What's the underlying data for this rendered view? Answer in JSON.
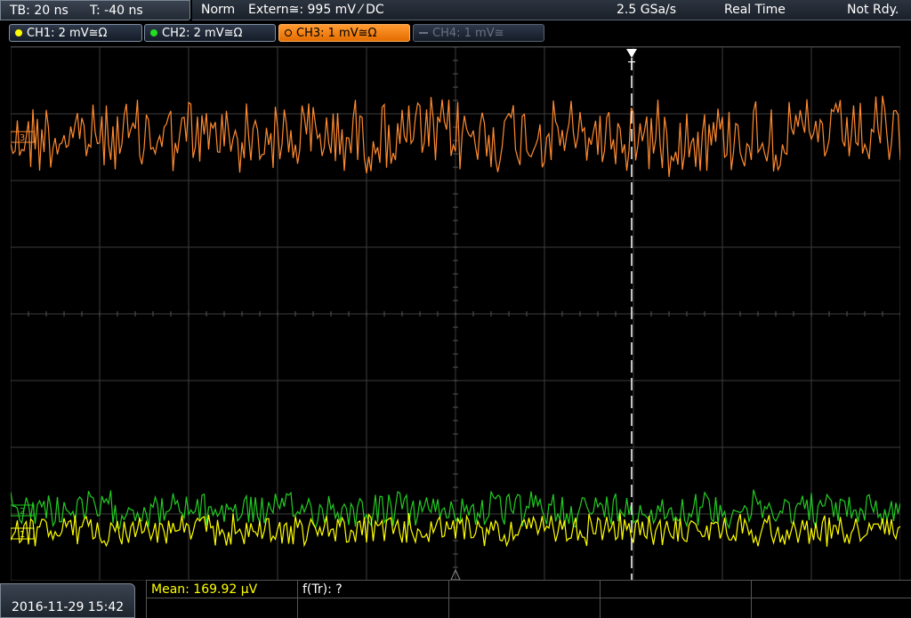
{
  "header": {
    "timebase": "TB: 20 ns",
    "trigger_offset": "T: -40 ns",
    "acq_mode": "Norm",
    "trigger_info": "Extern≅: 995 mV ⁄ DC",
    "sample_rate": "2.5 GSa/s",
    "acq_type": "Real Time",
    "run_status": "Not Rdy."
  },
  "channels": [
    {
      "label": "CH1: 2 mV≅Ω",
      "color": "#ffff00",
      "state": "on"
    },
    {
      "label": "CH2: 2 mV≅Ω",
      "color": "#22dd22",
      "state": "on"
    },
    {
      "label": "CH3: 1 mV≅Ω",
      "color": "#ff8a20",
      "state": "active"
    },
    {
      "label": "CH4: 1 mV≅",
      "color": "#6a7080",
      "state": "off"
    }
  ],
  "markers": {
    "ch3_marker": "3",
    "ch2_marker": "2",
    "ch1_marker": "1",
    "trigger_marker": "T"
  },
  "colors": {
    "ch1": "#ffff00",
    "ch2": "#22cc22",
    "ch3": "#ff8a30",
    "grid": "#3c3c3c",
    "trigger_line": "#ffffff"
  },
  "footer": {
    "datetime": "2016-11-29 15:42",
    "mean_label": "Mean: 169.92 µV",
    "ftr_label": "f(Tr): ?"
  }
}
